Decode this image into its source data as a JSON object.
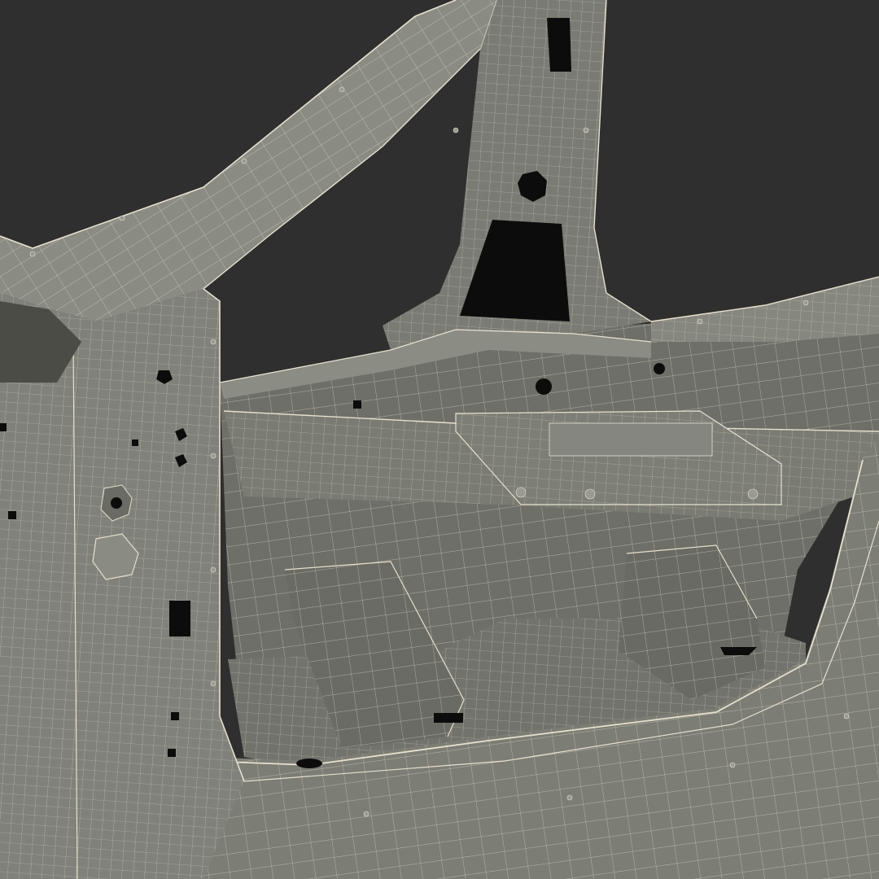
{
  "scene": {
    "subject": "car-body-frame-wireframe",
    "colors": {
      "background": "#2f2f2f",
      "surface": "#6f706a",
      "surface_light": "#8b8c84",
      "surface_dark": "#55564f",
      "wire": "#e6e1cf",
      "hole": "#0c0c0c"
    }
  }
}
